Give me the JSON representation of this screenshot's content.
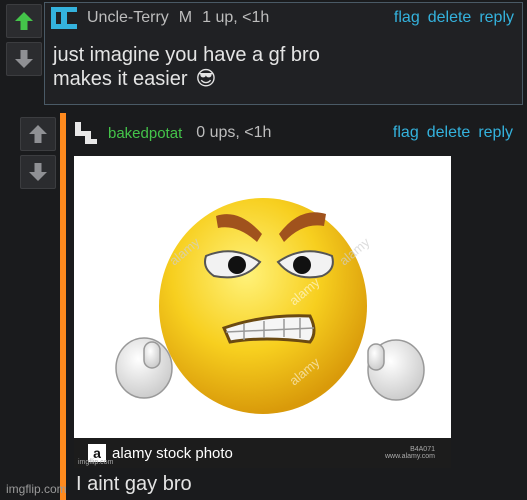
{
  "comment1": {
    "username": "Uncle-Terry",
    "badge": "M",
    "points": "1 up, <1h",
    "actions": [
      "flag",
      "delete",
      "reply"
    ],
    "text_line1": "just imagine you have a gf bro",
    "text_line2": "makes it easier",
    "emoji": "😎",
    "colors": {
      "username": "#bdbdbd",
      "upvote_active": "#44c44a",
      "accent": "#34b2dd"
    }
  },
  "comment2": {
    "username": "bakedpotat",
    "points": "0 ups, <1h",
    "actions": [
      "flag",
      "delete",
      "reply"
    ],
    "image_caption": "alamy stock photo",
    "image_ids": [
      "B4A071",
      "www.alamy.com"
    ],
    "image_watermark": "alamy",
    "image_attribution": "imgflip.com",
    "text": "I aint gay bro",
    "colors": {
      "username": "#44c44a",
      "reply_bar": "#ff8a1e"
    }
  },
  "footer": {
    "watermark": "imgflip.com"
  }
}
